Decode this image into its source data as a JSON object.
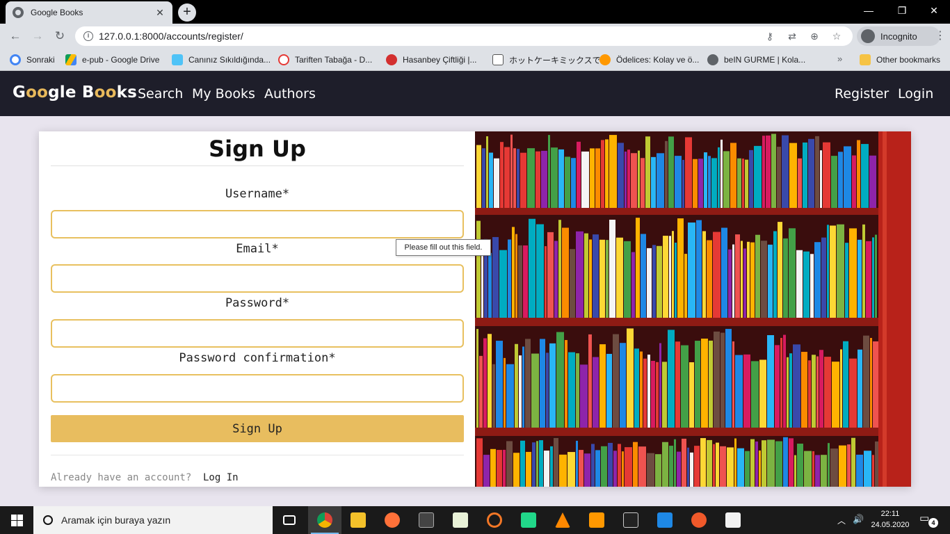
{
  "browser": {
    "tab_title": "Google Books",
    "url": "127.0.0.1:8000/accounts/register/",
    "incognito_label": "Incognito",
    "bookmarks": [
      {
        "label": "Sonraki",
        "icon": "google-icon"
      },
      {
        "label": "e-pub - Google Drive",
        "icon": "drive-icon"
      },
      {
        "label": "Canınız Sıkıldığında...",
        "icon": "link-icon"
      },
      {
        "label": "Tariften Tabağa - D...",
        "icon": "link-icon"
      },
      {
        "label": "Hasanbey Çiftliği |...",
        "icon": "tomato-icon"
      },
      {
        "label": "ホットケーキミックスで...",
        "icon": "link-icon"
      },
      {
        "label": "Ödelices: Kolay ve ö...",
        "icon": "link-icon"
      },
      {
        "label": "beIN GURME | Kola...",
        "icon": "globe-icon"
      }
    ],
    "bookmarks_more": "»",
    "other_bookmarks": "Other bookmarks"
  },
  "site": {
    "brand_parts": [
      "G",
      "oo",
      "gle B",
      "oo",
      "ks"
    ],
    "nav_left": [
      "Search",
      "My Books",
      "Authors"
    ],
    "nav_right": [
      "Register",
      "Login"
    ]
  },
  "form": {
    "title": "Sign Up",
    "fields": [
      {
        "label": "Username*",
        "value": ""
      },
      {
        "label": "Email*",
        "value": ""
      },
      {
        "label": "Password*",
        "value": ""
      },
      {
        "label": "Password confirmation*",
        "value": ""
      }
    ],
    "submit_label": "Sign Up",
    "already_text": "Already have an account?",
    "login_link": "Log In",
    "tooltip": "Please fill out this field."
  },
  "taskbar": {
    "search_placeholder": "Aramak için buraya yazın",
    "time": "22:11",
    "date": "24.05.2020",
    "notifications": "4",
    "apps": [
      "task-view-icon",
      "chrome-icon",
      "file-explorer-icon",
      "firefox-icon",
      "terminal-icon",
      "notepad-icon",
      "jupyter-icon",
      "pycharm-icon",
      "vlc-icon",
      "sublime-text-icon",
      "cmd-icon",
      "vscode-icon",
      "brave-icon",
      "typora-icon"
    ]
  },
  "colors": {
    "accent": "#e8bd5f",
    "navbar_bg": "#1e1e2a",
    "page_bg": "#e8e4ee"
  }
}
